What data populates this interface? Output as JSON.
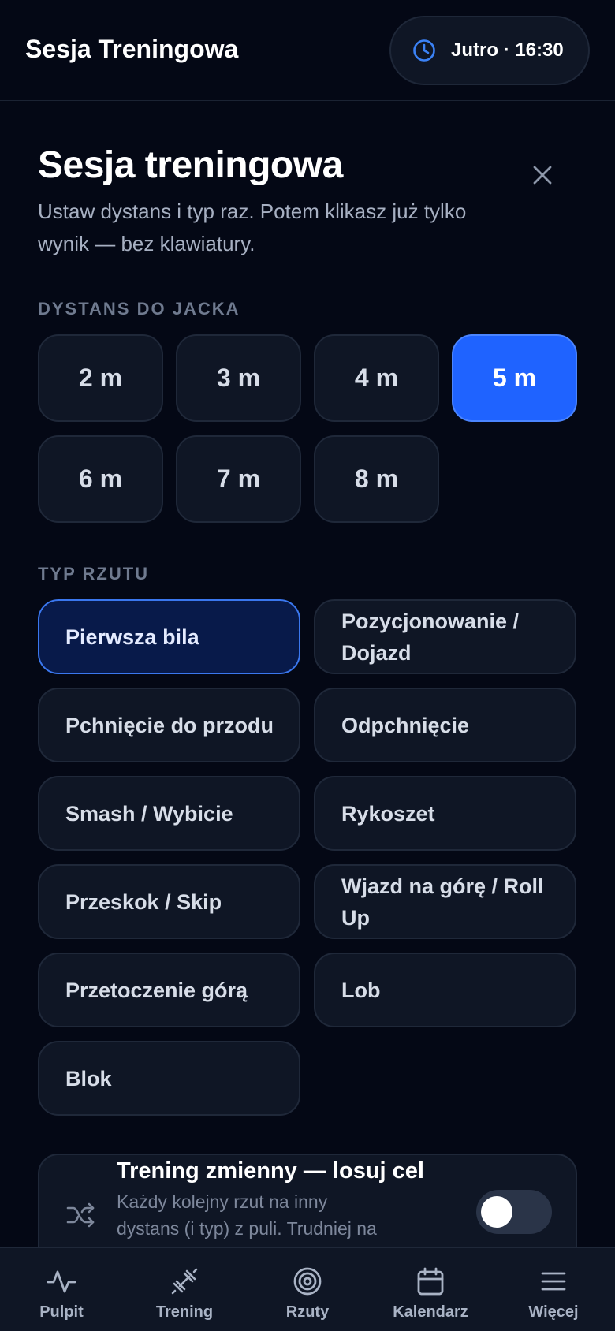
{
  "header": {
    "app_title": "Sesja Treningowa",
    "session_time": "Jutro · 16:30",
    "icon": "clock-icon"
  },
  "panel": {
    "title": "Sesja treningowa",
    "subtitle": "Ustaw dystans i typ raz. Potem klikasz już tylko wynik — bez klawiatury.",
    "close_icon": "close-icon"
  },
  "distance": {
    "label": "DYSTANS DO JACKA",
    "options": [
      "2 m",
      "3 m",
      "4 m",
      "5 m",
      "6 m",
      "7 m",
      "8 m"
    ],
    "selected": "5 m"
  },
  "throw_type": {
    "label": "TYP RZUTU",
    "options": [
      "Pierwsza bila",
      "Pozycjonowanie / Dojazd",
      "Pchnięcie do przodu",
      "Odpchnięcie",
      "Smash / Wybicie",
      "Rykoszet",
      "Przeskok / Skip",
      "Wjazd na górę / Roll Up",
      "Przetoczenie górą",
      "Lob",
      "Blok"
    ],
    "selected": "Pierwsza bila"
  },
  "random_training": {
    "title": "Trening zmienny — losuj cel",
    "description": "Każdy kolejny rzut na inny dystans (i typ) z puli. Trudniej na treningu, łatwiej na turnieju.",
    "enabled": false,
    "icon": "shuffle-icon"
  },
  "nav": {
    "items": [
      {
        "label": "Pulpit",
        "icon": "activity-icon"
      },
      {
        "label": "Trening",
        "icon": "dumbbell-icon"
      },
      {
        "label": "Rzuty",
        "icon": "target-icon"
      },
      {
        "label": "Kalendarz",
        "icon": "calendar-icon"
      },
      {
        "label": "Więcej",
        "icon": "menu-icon"
      }
    ]
  },
  "colors": {
    "background": "#040815",
    "surface": "#0f1625",
    "accent": "#1f63ff",
    "accent_icon": "#3b82f6",
    "selected_type_bg": "#081a4a"
  }
}
